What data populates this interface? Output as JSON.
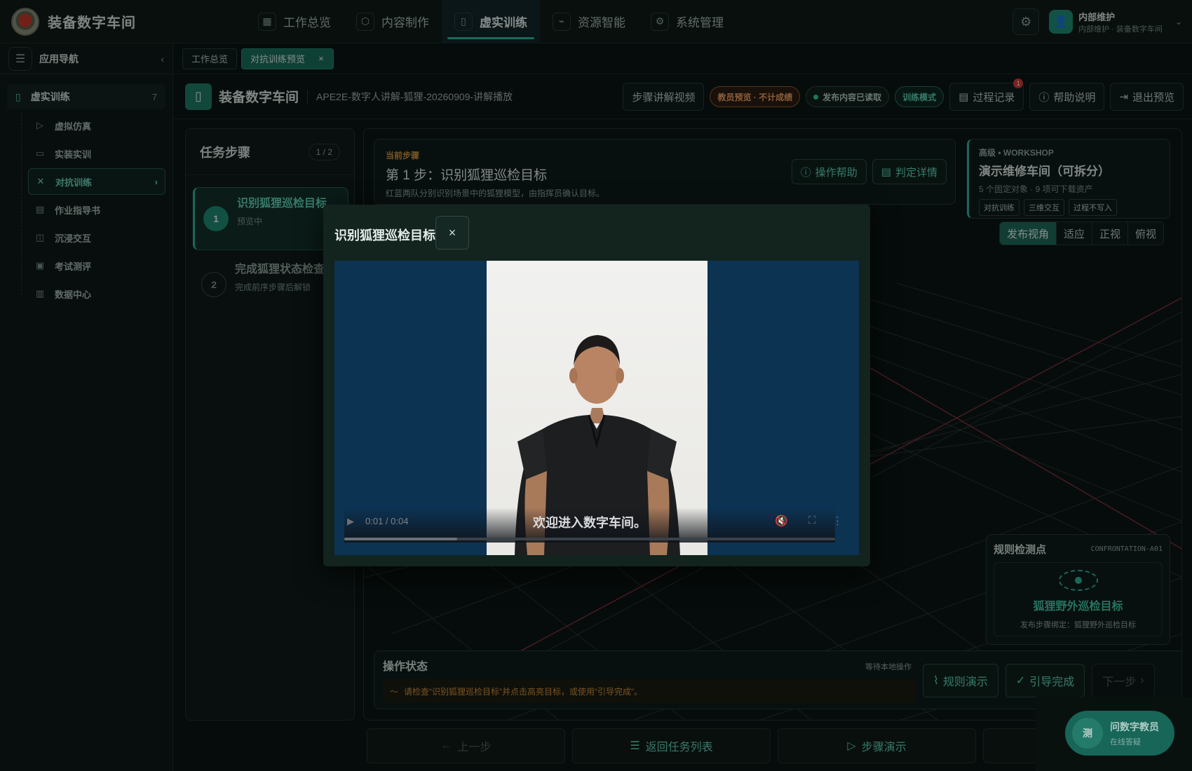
{
  "brand": {
    "name": "装备数字车间"
  },
  "nav": [
    {
      "label": "工作总览",
      "icon": "grid-icon",
      "active": false
    },
    {
      "label": "内容制作",
      "icon": "cube-icon",
      "active": false
    },
    {
      "label": "虚实训练",
      "icon": "book-icon",
      "active": true
    },
    {
      "label": "资源智能",
      "icon": "plug-icon",
      "active": false
    },
    {
      "label": "系统管理",
      "icon": "gear-icon",
      "active": false
    }
  ],
  "user": {
    "name": "内部维护",
    "sub": "内部维护 · 装备数字车间"
  },
  "sidebar": {
    "title": "应用导航",
    "group": {
      "label": "虚实训练",
      "count": "7"
    },
    "items": [
      {
        "label": "虚拟仿真",
        "icon": "play-circle-icon"
      },
      {
        "label": "实装实训",
        "icon": "monitor-icon"
      },
      {
        "label": "对抗训练",
        "icon": "swords-icon",
        "active": true
      },
      {
        "label": "作业指导书",
        "icon": "document-icon"
      },
      {
        "label": "沉浸交互",
        "icon": "vr-headset-icon"
      },
      {
        "label": "考试测评",
        "icon": "clipboard-icon"
      },
      {
        "label": "数据中心",
        "icon": "chart-icon"
      }
    ]
  },
  "tabs": [
    {
      "label": "工作总览"
    },
    {
      "label": "对抗训练预览",
      "active": true
    }
  ],
  "preview_header": {
    "title": "装备数字车间",
    "subtitle": "APE2E-数字人讲解-狐狸-20260909-讲解播放",
    "step_video_btn": "步骤讲解视频",
    "pill_instructor": "教员预览 · 不计成绩",
    "pill_published": "发布内容已读取",
    "pill_mode": "训练模式",
    "record_btn": "过程记录",
    "record_badge": "1",
    "help_btn": "帮助说明",
    "exit_btn": "退出预览"
  },
  "steps_panel": {
    "title": "任务步骤",
    "counter": "1 / 2",
    "steps": [
      {
        "num": "1",
        "title": "识别狐狸巡检目标",
        "status": "预览中"
      },
      {
        "num": "2",
        "title": "完成狐狸状态检查",
        "status": "完成前序步骤后解锁"
      }
    ]
  },
  "current_step": {
    "kicker": "当前步骤",
    "title": "第 1 步：识别狐狸巡检目标",
    "desc": "红蓝两队分别识别场景中的狐狸模型，由指挥员确认目标。",
    "op_help": "操作帮助",
    "judge_detail": "判定详情"
  },
  "workshop": {
    "kicker": "高级 • WORKSHOP",
    "title": "演示维修车间（可拆分）",
    "meta": "5 个固定对象 · 9 项可下载资产",
    "tags": [
      "对抗训练",
      "三维交互",
      "过程不写入"
    ]
  },
  "views": [
    "发布视角",
    "适应",
    "正视",
    "俯视"
  ],
  "rule": {
    "title": "规则检测点",
    "code": "CONFRONTATION-A01",
    "name": "狐狸野外巡检目标",
    "desc": "发布步骤绑定：狐狸野外巡检目标"
  },
  "ops": {
    "title": "操作状态",
    "waiting": "等待本地操作",
    "hint": "请检查“识别狐狸巡检目标”并点击高亮目标，或使用“引导完成”。",
    "rule_demo": "规则演示",
    "guide_done": "引导完成",
    "next": "下一步"
  },
  "bottom": {
    "prev": "上一步",
    "back_list": "返回任务列表",
    "step_demo": "步骤演示"
  },
  "assistant": {
    "avatar": "测",
    "name": "问数字教员",
    "status": "在线答疑"
  },
  "modal": {
    "title": "识别狐狸巡检目标",
    "time": "0:01 / 0:04",
    "caption": "欢迎进入数字车间。",
    "progress": 0.23
  },
  "colors": {
    "accent": "#2db39b",
    "warning": "#d3953f",
    "danger": "#d23a3a"
  }
}
